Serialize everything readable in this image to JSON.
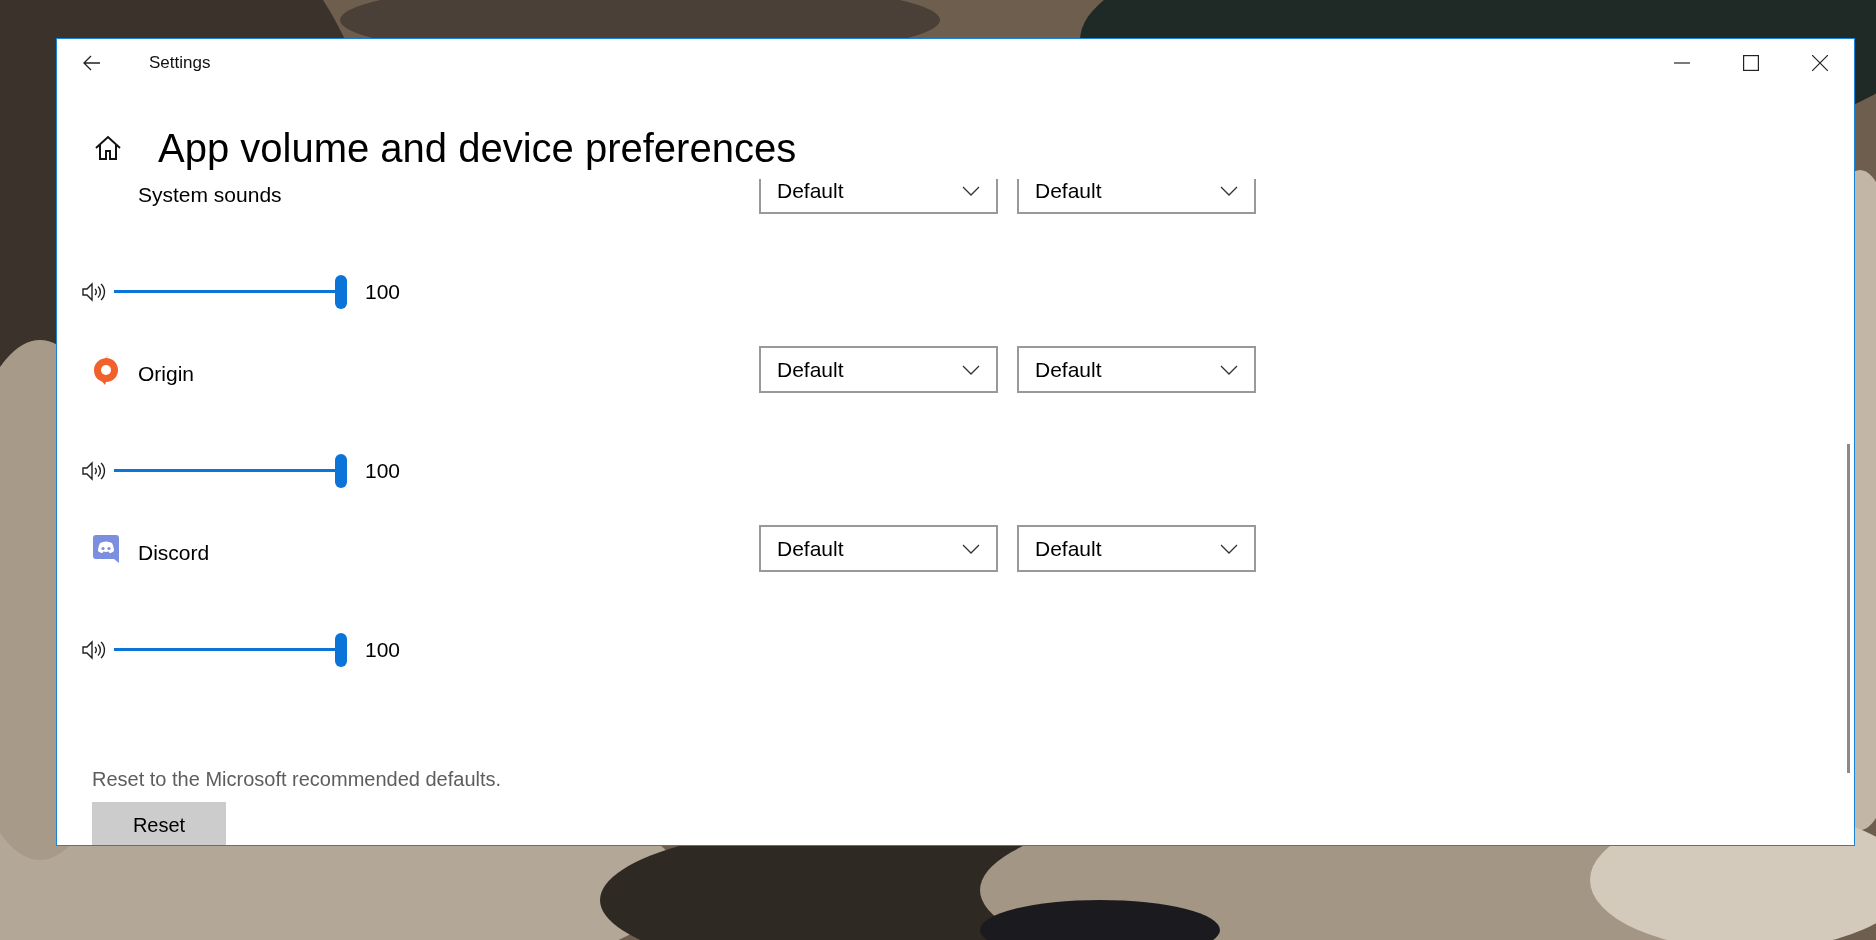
{
  "window": {
    "title": "Settings"
  },
  "page": {
    "title": "App volume and device preferences"
  },
  "apps": [
    {
      "name": "System sounds",
      "kind": "system",
      "output": "Default",
      "input": "Default",
      "volume": {
        "level": 1.0,
        "reading": "100"
      }
    },
    {
      "name": "Origin",
      "kind": "origin",
      "output": "Default",
      "input": "Default",
      "volume": {
        "level": 1.0,
        "reading": "100"
      }
    },
    {
      "name": "Discord",
      "kind": "discord",
      "output": "Default",
      "input": "Default",
      "volume": {
        "level": 1.0,
        "reading": "100"
      }
    }
  ],
  "reset": {
    "description": "Reset to the Microsoft recommended defaults.",
    "button": "Reset"
  }
}
